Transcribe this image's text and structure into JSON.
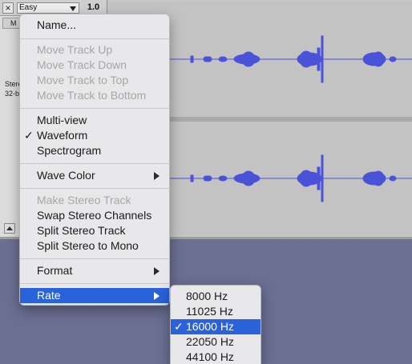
{
  "track": {
    "close_label": "×",
    "name": "Easy",
    "rate": "1.0",
    "mute_label": "M",
    "info_line1": "Stere",
    "info_line2": "32-b",
    "wave_color": "#4a52d8"
  },
  "menu": {
    "items": [
      {
        "label": "Name...",
        "enabled": true
      },
      {
        "label": "Move Track Up",
        "enabled": false
      },
      {
        "label": "Move Track Down",
        "enabled": false
      },
      {
        "label": "Move Track to Top",
        "enabled": false
      },
      {
        "label": "Move Track to Bottom",
        "enabled": false
      },
      {
        "label": "Multi-view",
        "enabled": true
      },
      {
        "label": "Waveform",
        "enabled": true,
        "checked": true
      },
      {
        "label": "Spectrogram",
        "enabled": true
      },
      {
        "label": "Wave Color",
        "enabled": true,
        "submenu": true
      },
      {
        "label": "Make Stereo Track",
        "enabled": false
      },
      {
        "label": "Swap Stereo Channels",
        "enabled": true
      },
      {
        "label": "Split Stereo Track",
        "enabled": true
      },
      {
        "label": "Split Stereo to Mono",
        "enabled": true
      },
      {
        "label": "Format",
        "enabled": true,
        "submenu": true
      },
      {
        "label": "Rate",
        "enabled": true,
        "submenu": true,
        "highlighted": true
      }
    ],
    "check_mark": "✓"
  },
  "rate_submenu": {
    "items": [
      {
        "label": "8000 Hz"
      },
      {
        "label": "11025 Hz"
      },
      {
        "label": "16000 Hz",
        "checked": true,
        "highlighted": true
      },
      {
        "label": "22050 Hz"
      },
      {
        "label": "44100 Hz"
      }
    ]
  }
}
